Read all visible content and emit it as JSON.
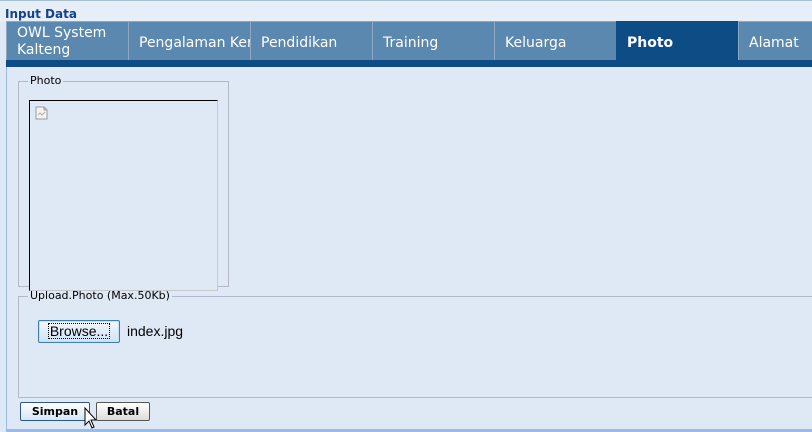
{
  "panel": {
    "title": "Input Data"
  },
  "tabs": [
    {
      "label": "OWL System Kalteng"
    },
    {
      "label": "Pengalaman Kerja"
    },
    {
      "label": "Pendidikan"
    },
    {
      "label": "Training"
    },
    {
      "label": "Keluarga"
    },
    {
      "label": "Photo",
      "active": true
    },
    {
      "label": "Alamat"
    }
  ],
  "photo_section": {
    "legend": "Photo",
    "image_icon": "broken-image-icon"
  },
  "upload_section": {
    "legend": "Upload.Photo (Max.50Kb)",
    "browse_label": "Browse...",
    "file_name": "index.jpg"
  },
  "actions": {
    "save_label": "Simpan",
    "cancel_label": "Batal"
  },
  "colors": {
    "tab_inactive": "#5b88af",
    "tab_active": "#0e4c86",
    "background": "#dfe9f6",
    "title_text": "#15428b"
  }
}
